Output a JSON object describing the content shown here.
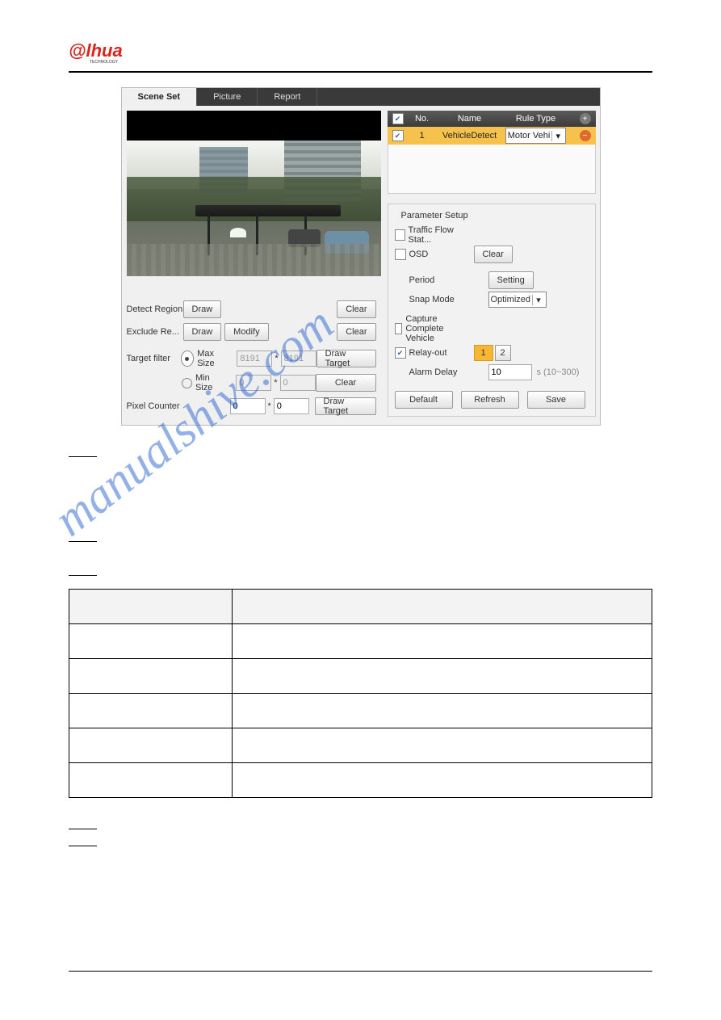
{
  "logo": {
    "brand": "alhua",
    "sub": "TECHNOLOGY"
  },
  "watermark": "manualshive.com",
  "tabs": {
    "scene_set": "Scene Set",
    "picture": "Picture",
    "report": "Report"
  },
  "controls": {
    "detect_region": "Detect Region",
    "exclude_region": "Exclude Re...",
    "target_filter": "Target filter",
    "max_size": "Max Size",
    "min_size": "Min Size",
    "pixel_counter": "Pixel Counter",
    "draw": "Draw",
    "modify": "Modify",
    "clear": "Clear",
    "draw_target": "Draw Target",
    "max_w": "8191",
    "max_h": "8191",
    "min_w": "0",
    "min_h": "0",
    "px_w": "0",
    "px_h": "0"
  },
  "rules": {
    "headers": {
      "check": "",
      "no": "No.",
      "name": "Name",
      "rule_type": "Rule Type",
      "add": ""
    },
    "row": {
      "no": "1",
      "name": "VehicleDetect",
      "rule_type": "Motor Vehi"
    }
  },
  "param": {
    "title": "Parameter Setup",
    "traffic_flow": "Traffic Flow Stat...",
    "osd": "OSD",
    "clear": "Clear",
    "period": "Period",
    "setting": "Setting",
    "snap_mode": "Snap Mode",
    "snap_mode_value": "Optimized",
    "capture_complete": "Capture Complete Vehicle",
    "relay_out": "Relay-out",
    "relay1": "1",
    "relay2": "2",
    "alarm_delay": "Alarm Delay",
    "alarm_delay_value": "10",
    "alarm_delay_unit": "s (10~300)",
    "default": "Default",
    "refresh": "Refresh",
    "save": "Save"
  }
}
